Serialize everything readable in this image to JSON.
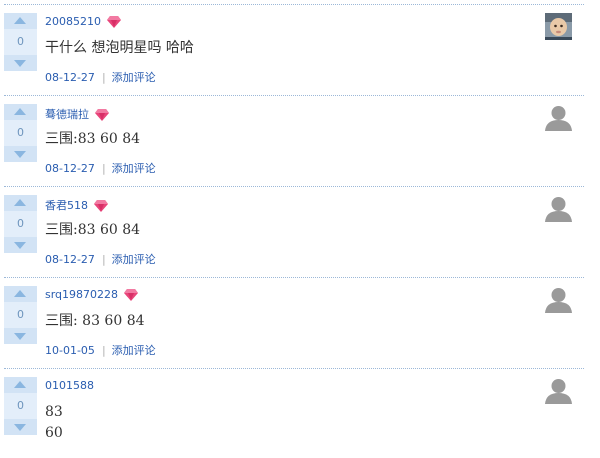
{
  "comments": [
    {
      "author": "20085210",
      "gem": true,
      "votes": "0",
      "lines": [
        "干什么 想泡明星吗 哈哈"
      ],
      "date": "08-12-27",
      "separator": "|",
      "add_comment": "添加评论",
      "avatar": "child-photo"
    },
    {
      "author": "蓦德瑞拉",
      "gem": true,
      "votes": "0",
      "lines": [
        "三围:83 60 84"
      ],
      "date": "08-12-27",
      "separator": "|",
      "add_comment": "添加评论",
      "avatar": "default-silhouette"
    },
    {
      "author": "香君518",
      "gem": true,
      "votes": "0",
      "lines": [
        "三围:83 60 84"
      ],
      "date": "08-12-27",
      "separator": "|",
      "add_comment": "添加评论",
      "avatar": "default-silhouette"
    },
    {
      "author": "srq19870228",
      "gem": true,
      "votes": "0",
      "lines": [
        "三围: 83 60 84"
      ],
      "date": "10-01-05",
      "separator": "|",
      "add_comment": "添加评论",
      "avatar": "default-silhouette"
    },
    {
      "author": "0101588",
      "gem": false,
      "votes": "0",
      "lines": [
        "83",
        "60"
      ],
      "date": "",
      "separator": "",
      "add_comment": "",
      "avatar": "default-silhouette"
    }
  ]
}
